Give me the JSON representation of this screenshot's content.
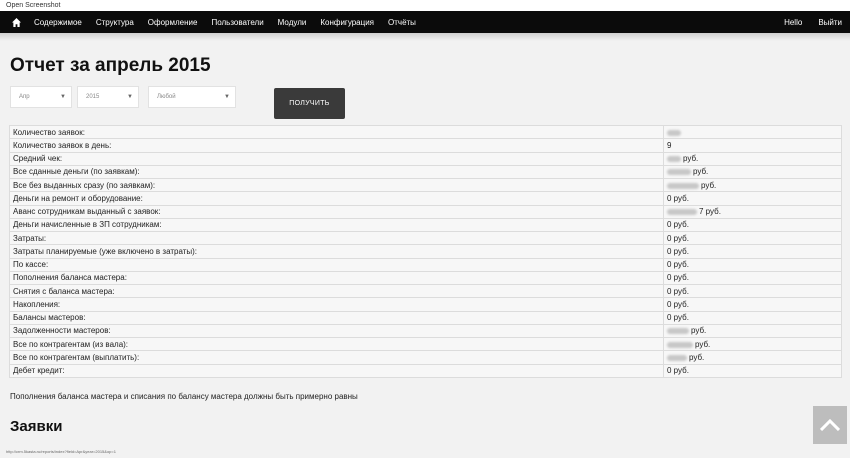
{
  "os_bar_title": "Open Screenshot",
  "nav": {
    "items": [
      "Содержимое",
      "Структура",
      "Оформление",
      "Пользователи",
      "Модули",
      "Конфигурация",
      "Отчёты"
    ],
    "right": [
      "Hello",
      "Выйти"
    ]
  },
  "page_title": "Отчет за апрель 2015",
  "filters": {
    "month": "Апр",
    "year": "2015",
    "other": "Любой"
  },
  "submit_label": "ПОЛУЧИТЬ",
  "rows": [
    {
      "label": "Количество заявок:",
      "value": ""
    },
    {
      "label": "Количество заявок в день:",
      "value": "9"
    },
    {
      "label": "Средний чек:",
      "value": "руб."
    },
    {
      "label": "Все сданные деньги (по заявкам):",
      "value": "руб."
    },
    {
      "label": "Все без выданных сразу (по заявкам):",
      "value": "руб."
    },
    {
      "label": "Деньги на ремонт и оборудование:",
      "value": "0 руб."
    },
    {
      "label": "Аванс сотрудникам выданный с заявок:",
      "value": "7 руб."
    },
    {
      "label": "Деньги начисленные в ЗП сотрудникам:",
      "value": "0 руб."
    },
    {
      "label": "Затраты:",
      "value": "0 руб."
    },
    {
      "label": "Затраты планируемые (уже включено в затраты):",
      "value": "0 руб."
    },
    {
      "label": "По кассе:",
      "value": "0 руб."
    },
    {
      "label": "Пополнения баланса мастера:",
      "value": "0 руб."
    },
    {
      "label": "Снятия с баланса мастера:",
      "value": "0 руб."
    },
    {
      "label": "Накопления:",
      "value": "0 руб."
    },
    {
      "label": "Балансы мастеров:",
      "value": "0 руб."
    },
    {
      "label": "Задолженности мастеров:",
      "value": "руб."
    },
    {
      "label": "Все по контрагентам (из вала):",
      "value": "руб."
    },
    {
      "label": "Все по контрагентам (выплатить):",
      "value": "руб."
    },
    {
      "label": "Дебет кредит:",
      "value": "0 руб."
    }
  ],
  "note": "Пополнения баланса мастера и списания по балансу мастера должны быть примерно равны",
  "section_title": "Заявки",
  "status_url": "http://crm.5kasta.ru/reports/index?field=Apr&year=2015&op=1"
}
